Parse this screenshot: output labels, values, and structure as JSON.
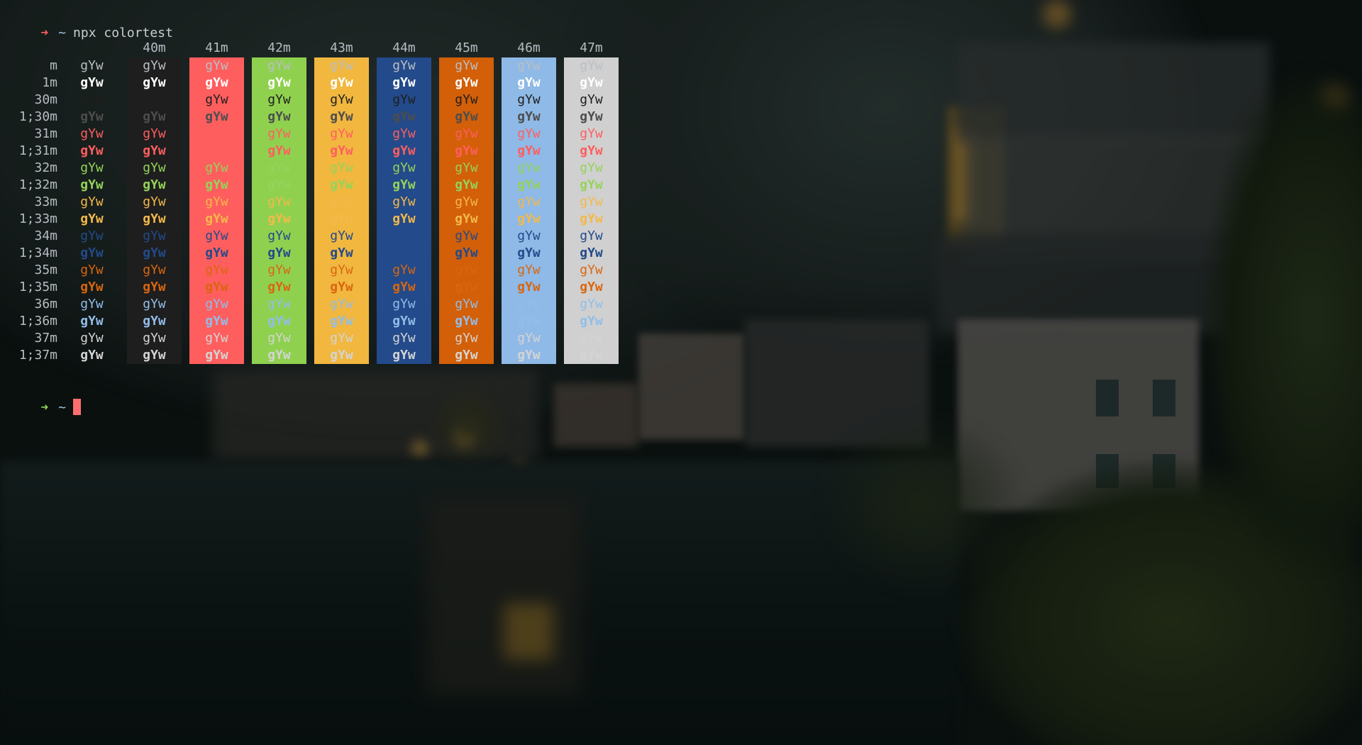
{
  "terminal": {
    "command_line": {
      "prompt_symbol": "➜",
      "cwd": "~",
      "command": "npx colortest"
    },
    "prompt_line": {
      "prompt_symbol": "➜",
      "cwd": "~"
    }
  },
  "colortest": {
    "column_headers": [
      "40m",
      "41m",
      "42m",
      "43m",
      "44m",
      "45m",
      "46m",
      "47m"
    ],
    "background_colors": [
      "#1e1e1e",
      "#ff5e5e",
      "#8fd14f",
      "#f1b73f",
      "#234a8a",
      "#d35f08",
      "#8fb9e6",
      "#d0d0d0"
    ],
    "row_labels": [
      "m",
      "1m",
      "30m",
      "1;30m",
      "31m",
      "1;31m",
      "32m",
      "1;32m",
      "33m",
      "1;33m",
      "34m",
      "1;34m",
      "35m",
      "1;35m",
      "36m",
      "1;36m",
      "37m",
      "1;37m"
    ],
    "sample_text": "gYw",
    "foreground_colors": {
      "default": "#b9bfc4",
      "default_bold": "#ffffff",
      "black": "#1e1e1e",
      "black_bold": "#4d4d4d",
      "red": "#ff5e5e",
      "green": "#95d35a",
      "yellow": "#f3b94a",
      "blue": "#234a8a",
      "orange": "#d9660f",
      "cyan": "#92bde9",
      "white": "#d4d4d4"
    }
  }
}
